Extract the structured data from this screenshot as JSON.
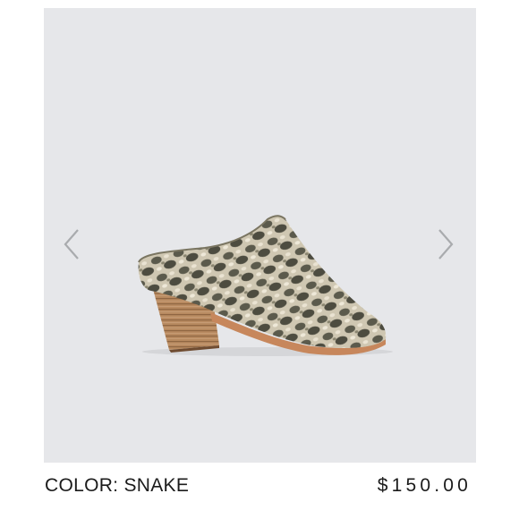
{
  "product": {
    "image_alt": "Snake print leather mule with stacked wooden heel",
    "color_label": "COLOR:",
    "color_value": "SNAKE",
    "price": "$150.00"
  },
  "gallery": {
    "prev_icon": "chevron-left-icon",
    "next_icon": "chevron-right-icon",
    "background_color": "#e6e7ea",
    "arrow_color": "#a9abae"
  }
}
